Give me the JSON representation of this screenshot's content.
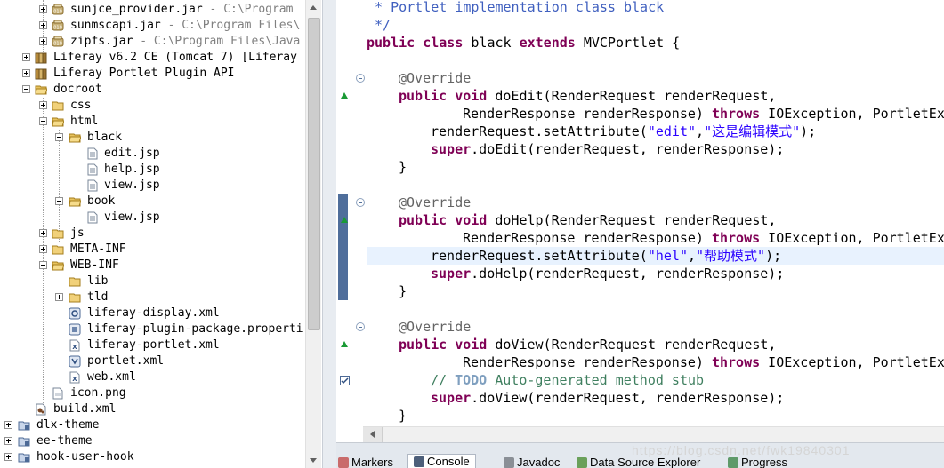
{
  "tree": {
    "rows": [
      {
        "label": "sunjce_provider.jar",
        "path": " - C:\\Program"
      },
      {
        "label": "sunmscapi.jar",
        "path": " - C:\\Program Files\\"
      },
      {
        "label": "zipfs.jar",
        "path": " - C:\\Program Files\\Java"
      },
      {
        "label": "Liferay v6.2 CE (Tomcat 7) [Liferay"
      },
      {
        "label": "Liferay Portlet Plugin API"
      },
      {
        "label": "docroot"
      },
      {
        "label": "css"
      },
      {
        "label": "html"
      },
      {
        "label": "black"
      },
      {
        "label": "edit.jsp"
      },
      {
        "label": "help.jsp"
      },
      {
        "label": "view.jsp"
      },
      {
        "label": "book"
      },
      {
        "label": "view.jsp"
      },
      {
        "label": "js"
      },
      {
        "label": "META-INF"
      },
      {
        "label": "WEB-INF"
      },
      {
        "label": "lib"
      },
      {
        "label": "tld"
      },
      {
        "label": "liferay-display.xml"
      },
      {
        "label": "liferay-plugin-package.properti"
      },
      {
        "label": "liferay-portlet.xml"
      },
      {
        "label": "portlet.xml"
      },
      {
        "label": "web.xml"
      },
      {
        "label": "icon.png"
      },
      {
        "label": "build.xml"
      },
      {
        "label": "dlx-theme"
      },
      {
        "label": "ee-theme"
      },
      {
        "label": "hook-user-hook"
      }
    ]
  },
  "editor": {
    "lines": {
      "l0": " * Portlet implementation class black",
      "l1": " */",
      "l2_kw1": "public class",
      "l2_name": " black ",
      "l2_kw2": "extends",
      "l2_rest": " MVCPortlet {",
      "override": "@Override",
      "pv": "public void",
      "doEdit": " doEdit(RenderRequest renderRequest,",
      "resp": "RenderResponse renderResponse) ",
      "throws": "throws",
      "exc": " IOException, PortletEx",
      "setEdit_pre": "renderRequest.setAttribute(",
      "setEdit_k": "\"edit\"",
      "comma": ",",
      "setEdit_v": "\"这是编辑模式\"",
      "close_paren": ");",
      "super": "super",
      "superEdit": ".doEdit(renderRequest, renderResponse);",
      "brace": "}",
      "doHelp": " doHelp(RenderRequest renderRequest,",
      "setHelp_k": "\"hel\"",
      "setHelp_v": "\"帮助模式\"",
      "superHelp": ".doHelp(renderRequest, renderResponse);",
      "doView": " doView(RenderRequest renderRequest,",
      "todo_pre": "// ",
      "todo": "TODO",
      "todo_rest": " Auto-generated method stub",
      "superView": ".doView(renderRequest, renderResponse);"
    }
  },
  "bottom_tabs": [
    "Markers",
    "Console",
    "Javadoc",
    "Data Source Explorer",
    "Progress"
  ],
  "watermark": "https://blog.csdn.net/fwk19840301"
}
